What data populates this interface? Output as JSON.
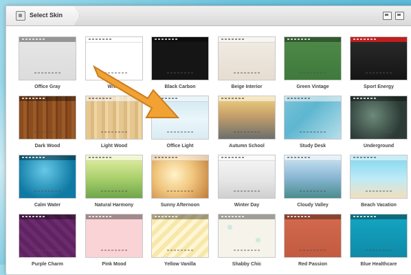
{
  "window": {
    "title": "Select Skin",
    "title_icon": "skin-icon",
    "buttons": [
      "save-icon",
      "folder-icon"
    ]
  },
  "skins": [
    {
      "name": "Office Gray",
      "bg": "linear-gradient(#e6e6e6,#dcdcdc)",
      "bar": "dark"
    },
    {
      "name": "White",
      "bg": "#ffffff",
      "bar": "light"
    },
    {
      "name": "Black Carbon",
      "bg": "#151515",
      "bar": "dark"
    },
    {
      "name": "Beige Interior",
      "bg": "linear-gradient(#f1ece4,#e6ddd0)",
      "bar": "light"
    },
    {
      "name": "Green Vintage",
      "bg": "linear-gradient(#4f8a4a,#3f7a3c)",
      "bar": "dark"
    },
    {
      "name": "Sport Energy",
      "bg": "linear-gradient(#2b2b2b,#151515)",
      "bar": "red"
    },
    {
      "name": "Dark Wood",
      "bg": "repeating-linear-gradient(90deg,#8b4d1f 0 6px,#9b5a27 6px 11px,#7b4018 11px 14px)",
      "bar": "dark"
    },
    {
      "name": "Light Wood",
      "bg": "repeating-linear-gradient(90deg,#e6c790 0 7px,#dcbb80 7px 12px,#f0d5a4 12px 16px)",
      "bar": "light"
    },
    {
      "name": "Office Light",
      "bg": "linear-gradient(#cfe7f1,#eaf6fb 55%,#d9ebf2)",
      "bar": "light"
    },
    {
      "name": "Autumn School",
      "bg": "linear-gradient(#f2d27d,#c6a06b 45%,#6b6f6c)",
      "bar": "light"
    },
    {
      "name": "Study Desk",
      "bg": "linear-gradient(135deg,#7ac4d9,#5db6d0 40%,#b7dfeb)",
      "bar": "light"
    },
    {
      "name": "Underground",
      "bg": "radial-gradient(circle at 40% 45%,#6d8a7b,#2c3b36 70%)",
      "bar": "dark"
    },
    {
      "name": "Calm Water",
      "bg": "radial-gradient(circle at 45% 35%,#67c9e8,#0f7aa4 70%)",
      "bar": "dark"
    },
    {
      "name": "Natural Harmony",
      "bg": "linear-gradient(#e7f0a5,#a8cf6b 55%,#6ea64a)",
      "bar": "light"
    },
    {
      "name": "Sunny Afternoon",
      "bg": "radial-gradient(circle at 40% 45%,#fff3c8,#f1c67e 45%,#c07c3a)",
      "bar": "light"
    },
    {
      "name": "Winter Day",
      "bg": "linear-gradient(#f7f7f7,#e5e5e5 60%,#cfcfcf)",
      "bar": "light"
    },
    {
      "name": "Cloudy Valley",
      "bg": "linear-gradient(#cfe6f5,#8bb9d6 50%,#4a8c8f)",
      "bar": "light"
    },
    {
      "name": "Beach Vacation",
      "bg": "linear-gradient(#7dd6ef,#bfeaf7 55%,#f2dfbd)",
      "bar": "light"
    },
    {
      "name": "Purple Charm",
      "bg": "repeating-linear-gradient(45deg,#6d2b6f 0 6px,#5e2360 6px 12px)",
      "bar": "dark"
    },
    {
      "name": "Pink Mood",
      "bg": "#f9d3d6",
      "bar": "dark"
    },
    {
      "name": "Yellow Vanilla",
      "bg": "repeating-linear-gradient(135deg,#fff6d3 0 6px,#f7e7aa 6px 12px)",
      "bar": "dark"
    },
    {
      "name": "Shabby Chic",
      "bg": "radial-gradient(circle at 20% 30%,#cfe8e2 0 3px,transparent 4px),radial-gradient(circle at 70% 60%,#cfe8e2 0 3px,transparent 4px),#f6f3ea",
      "bar": "dark"
    },
    {
      "name": "Red Passion",
      "bg": "linear-gradient(#d46a4f,#c25b40)",
      "bar": "dark"
    },
    {
      "name": "Blue Healthcare",
      "bg": "linear-gradient(#15a6c3,#0e8aa7)",
      "bar": "dark"
    }
  ],
  "callout": {
    "type": "arrow",
    "color": "#f2a233"
  }
}
